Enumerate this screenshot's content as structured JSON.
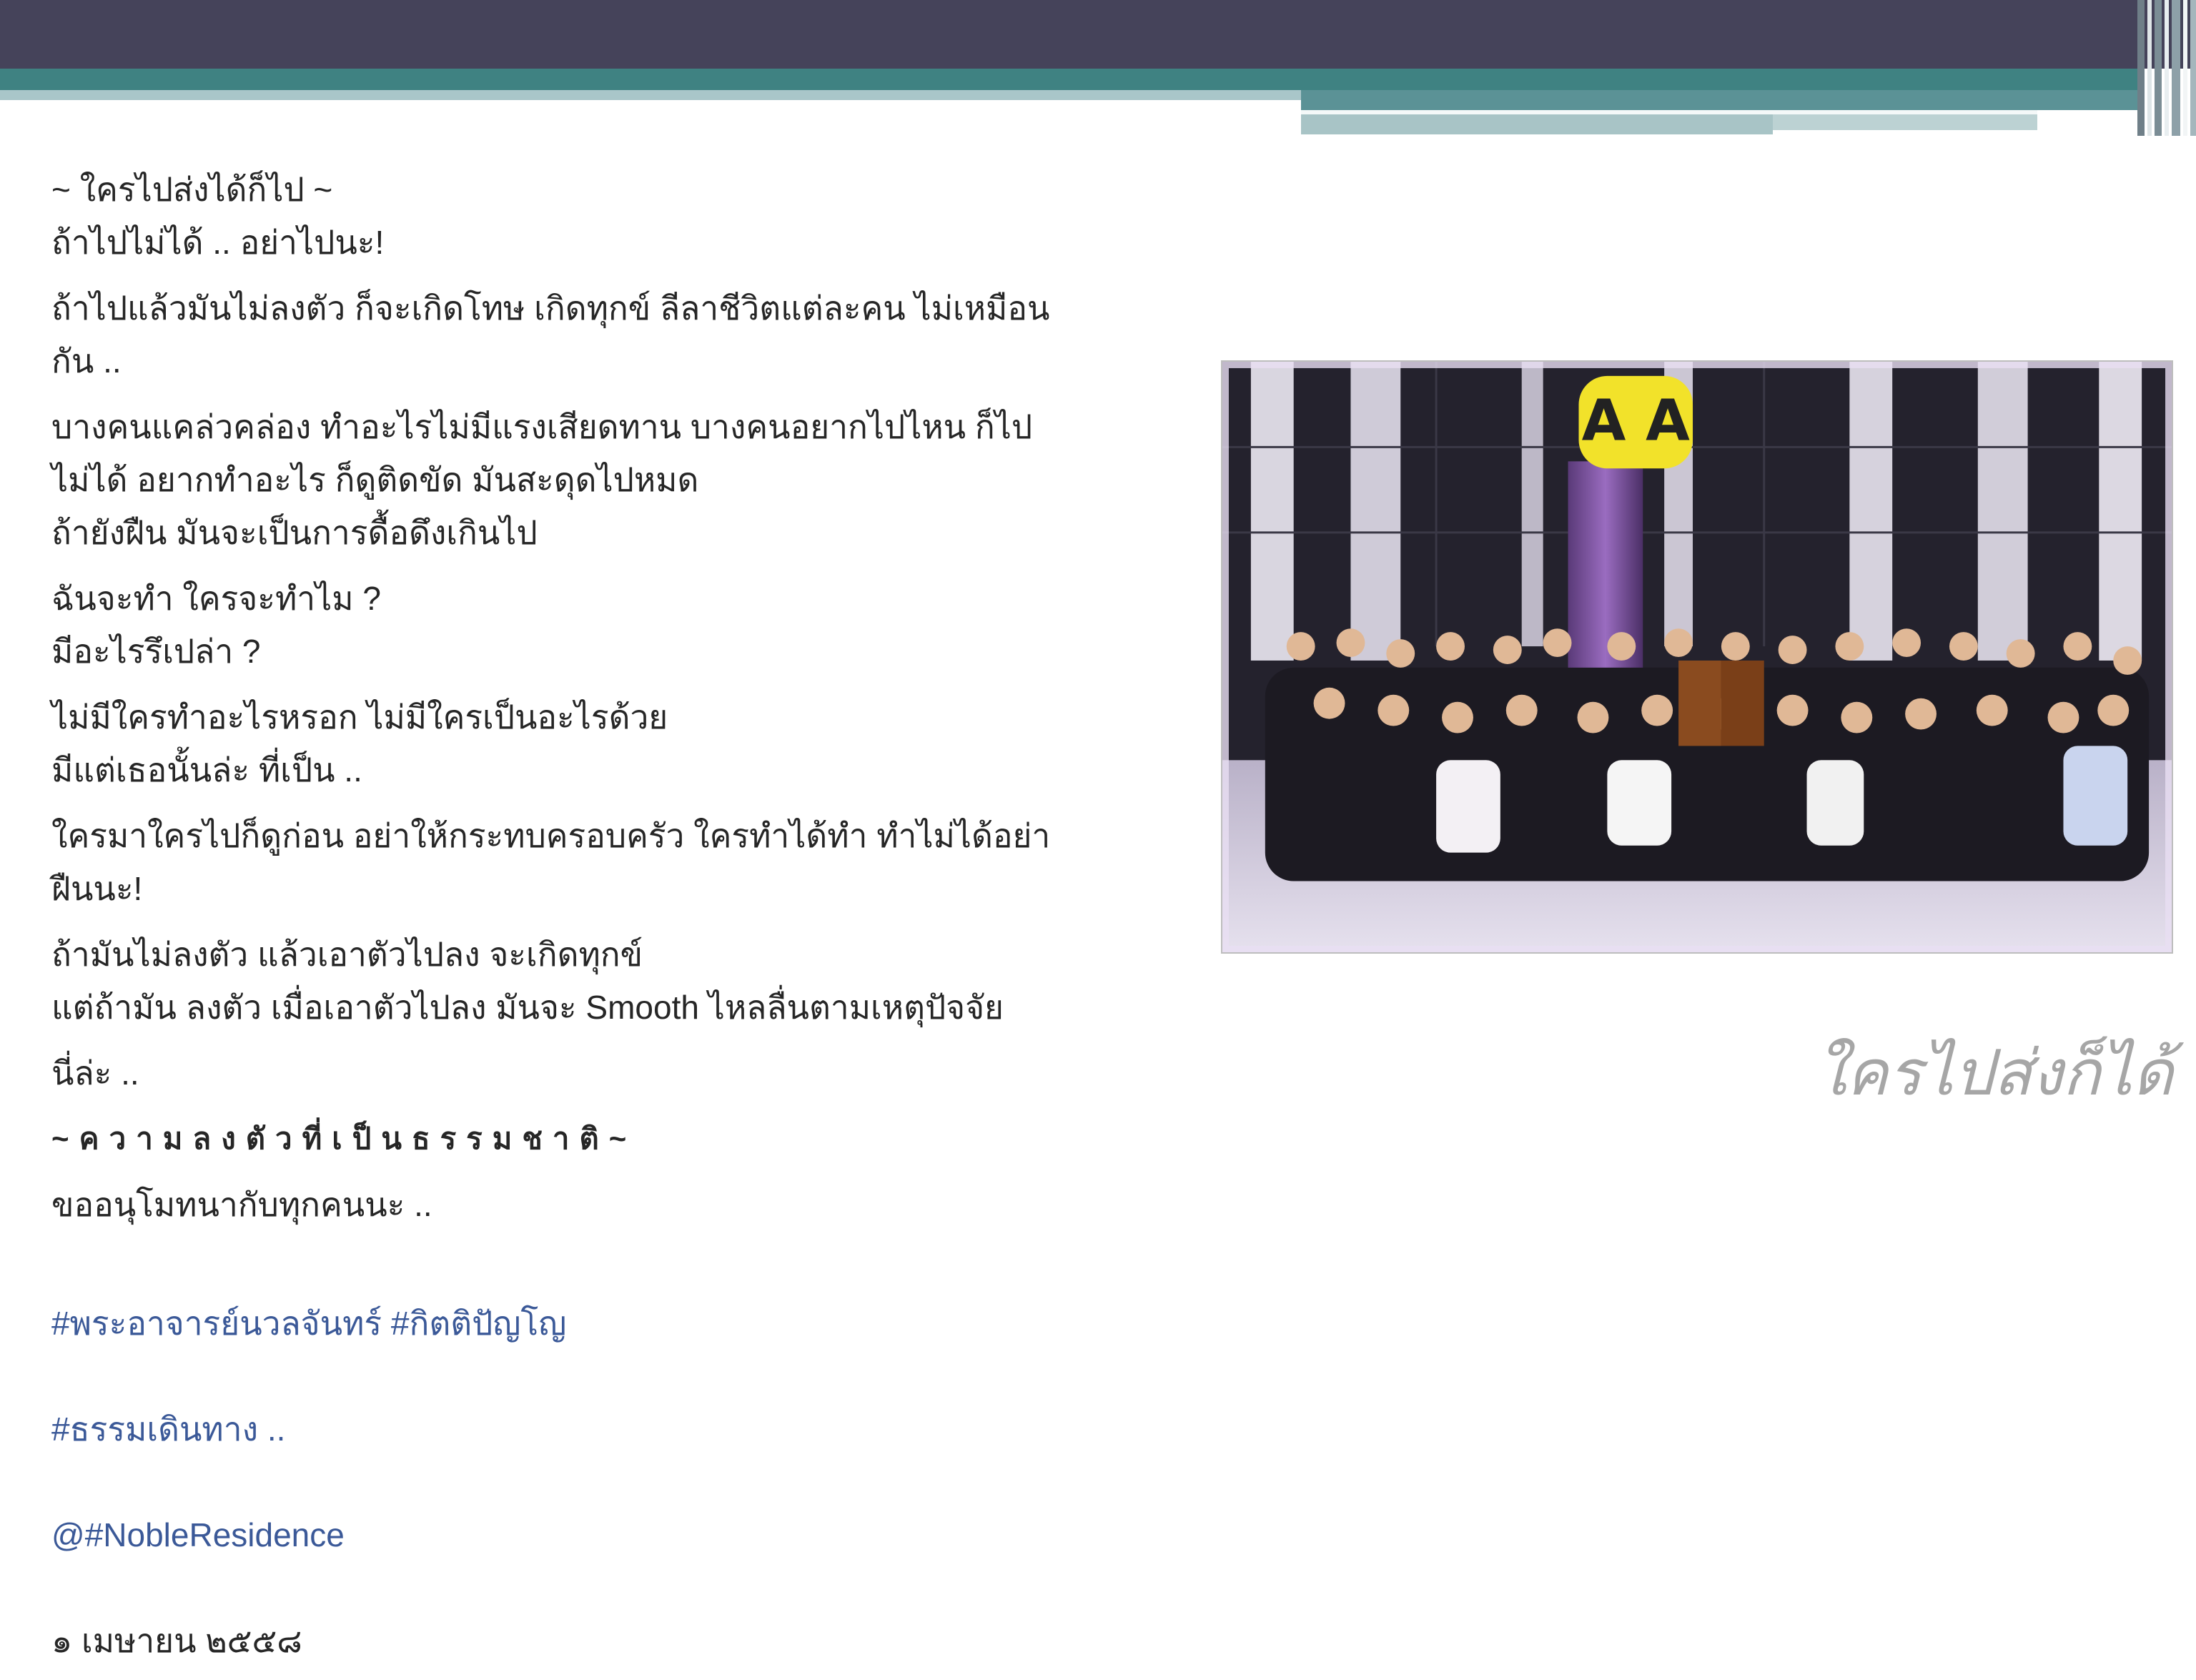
{
  "slide": {
    "colors": {
      "topbar": "#45435a",
      "accent_teal": "#3f8282",
      "hashtag": "#3b5998",
      "caption": "#a6a6a6",
      "body_text": "#262626"
    }
  },
  "post": {
    "heading1": "~ ใครไปส่งได้ก็ไป ~",
    "heading2": "ถ้าไปไม่ได้ .. อย่าไปนะ!",
    "p1": "ถ้าไปแล้วมันไม่ลงตัว ก็จะเกิดโทษ เกิดทุกข์ ลีลาชีวิตแต่ละคน ไม่เหมือน\nกัน ..",
    "p2": "บางคนแคล่วคล่อง ทำอะไรไม่มีแรงเสียดทาน บางคนอยากไปไหน ก็ไป\nไม่ได้ อยากทำอะไร ก็ดูติดขัด มันสะดุดไปหมด\nถ้ายังฝืน มันจะเป็นการดื้อดึงเกินไป",
    "p3": "ฉันจะทำ ใครจะทำไม ?\nมีอะไรรึเปล่า ?",
    "p4": "ไม่มีใครทำอะไรหรอก ไม่มีใครเป็นอะไรด้วย\nมีแต่เธอนั้นล่ะ ที่เป็น ..",
    "p5": "ใครมาใครไปก็ดูก่อน อย่าให้กระทบครอบครัว ใครทำได้ทำ ทำไม่ได้อย่า\nฝืนนะ!",
    "p6": "ถ้ามันไม่ลงตัว แล้วเอาตัวไปลง จะเกิดทุกข์\nแต่ถ้ามัน ลงตัว เมื่อเอาตัวไปลง มันจะ Smooth ไหลลื่นตามเหตุปัจจัย",
    "p7": "นี่ล่ะ ..",
    "p8": "~ความลงตัวที่เป็นธรรมชาติ~",
    "p9": "ขออนุโมทนากับทุกคนนะ ..",
    "tag1": "#พระอาจารย์นวลจันทร์ #กิตติปัญโญ",
    "tag2": "#ธรรมเดินทาง ..",
    "tag3": "@#NobleResidence",
    "date": "๑ เมษายน ๒๕๕๘"
  },
  "photo": {
    "sign_letters": "A A"
  },
  "caption": "ใครไปส่งก็ได้"
}
